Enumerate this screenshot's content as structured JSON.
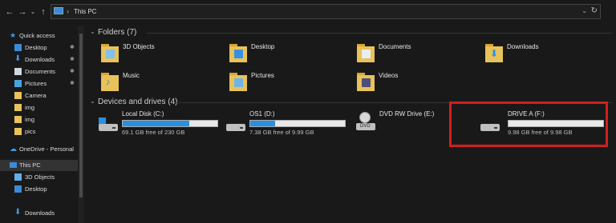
{
  "window": {
    "address": {
      "separator": "›",
      "location": "This PC"
    },
    "nav": {
      "back": "←",
      "forward": "→",
      "history": "⌄",
      "up": "↑",
      "refresh": "↻",
      "dropdown": "⌄"
    }
  },
  "sidebar": {
    "items": [
      {
        "label": "Quick access",
        "icon": "star-icon",
        "pinned": false
      },
      {
        "label": "Desktop",
        "icon": "desktop-icon",
        "pinned": true
      },
      {
        "label": "Downloads",
        "icon": "download-icon",
        "pinned": true
      },
      {
        "label": "Documents",
        "icon": "documents-icon",
        "pinned": true
      },
      {
        "label": "Pictures",
        "icon": "pictures-icon",
        "pinned": true
      },
      {
        "label": "Camera",
        "icon": "folder-icon",
        "pinned": false
      },
      {
        "label": "img",
        "icon": "folder-icon",
        "pinned": false
      },
      {
        "label": "img",
        "icon": "folder-icon",
        "pinned": false
      },
      {
        "label": "pics",
        "icon": "folder-icon",
        "pinned": false
      },
      {
        "label": "OneDrive - Personal",
        "icon": "cloud-icon",
        "pinned": false
      },
      {
        "label": "This PC",
        "icon": "computer-icon",
        "pinned": false,
        "selected": true
      },
      {
        "label": "3D Objects",
        "icon": "3d-objects-icon",
        "pinned": false
      },
      {
        "label": "Desktop",
        "icon": "desktop-icon",
        "pinned": false
      },
      {
        "label": "Downloads",
        "icon": "download-icon",
        "pinned": false
      }
    ],
    "pin_glyph": "📌"
  },
  "folders": {
    "header": "Folders (7)",
    "items": [
      {
        "label": "3D Objects",
        "icon": "3d-objects-icon"
      },
      {
        "label": "Desktop",
        "icon": "desktop-folder-icon"
      },
      {
        "label": "Documents",
        "icon": "documents-folder-icon"
      },
      {
        "label": "Downloads",
        "icon": "downloads-folder-icon"
      },
      {
        "label": "Music",
        "icon": "music-folder-icon"
      },
      {
        "label": "Pictures",
        "icon": "pictures-folder-icon"
      },
      {
        "label": "Videos",
        "icon": "videos-folder-icon"
      }
    ]
  },
  "drives": {
    "header": "Devices and drives (4)",
    "items": [
      {
        "name": "Local Disk (C:)",
        "free": "69.1 GB free of 230 GB",
        "used_fraction": 0.7,
        "icon": "windows-drive-icon"
      },
      {
        "name": "OS1 (D:)",
        "free": "7.38 GB free of 9.99 GB",
        "used_fraction": 0.26,
        "icon": "drive-icon"
      },
      {
        "name": "DVD RW Drive (E:)",
        "free": "",
        "used_fraction": null,
        "icon": "dvd-drive-icon",
        "dvd_label": "DVD"
      },
      {
        "name": "DRIVE A (F:)",
        "free": "9.98 GB free of 9.98 GB",
        "used_fraction": 0.0,
        "icon": "drive-icon"
      }
    ]
  },
  "colors": {
    "accent": "#2b8fe0",
    "highlight": "#d11f1f",
    "folder": "#e8c25a",
    "background": "#191919"
  }
}
